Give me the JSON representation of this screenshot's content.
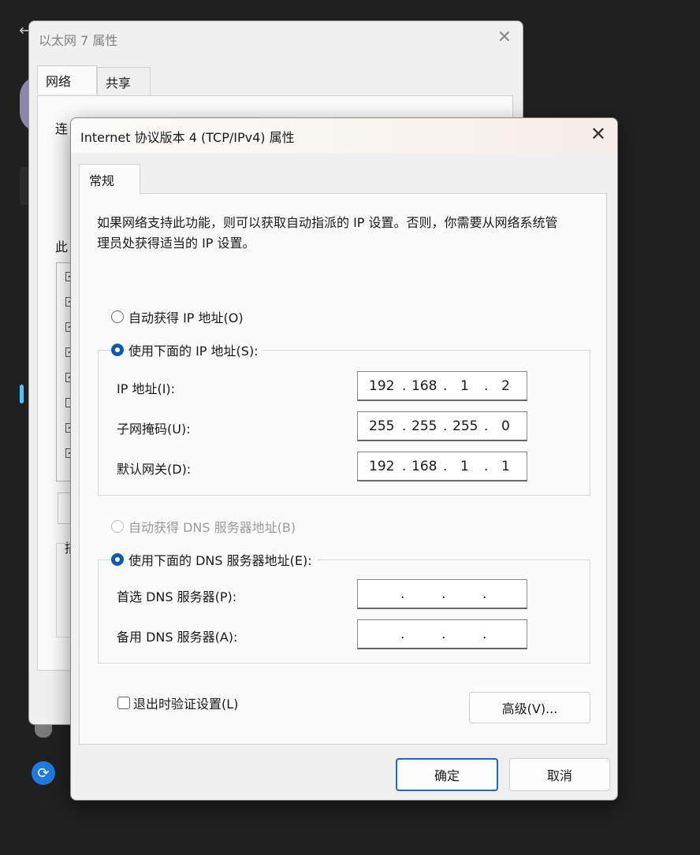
{
  "background_window": {
    "title": "以太网 7 属性",
    "tabs": [
      "网络",
      "共享"
    ],
    "fragment_connect": "连",
    "fragment_this": "此",
    "fragment_other": "描"
  },
  "dialog": {
    "title": "Internet 协议版本 4 (TCP/IPv4) 属性",
    "tab": "常规",
    "description": "如果网络支持此功能，则可以获取自动指派的 IP 设置。否则，你需要从网络系统管理员处获得适当的 IP 设置。",
    "radio_auto_ip": "自动获得 IP 地址(O)",
    "radio_manual_ip": "使用下面的 IP 地址(S):",
    "ip_label": "IP 地址(I):",
    "ip": [
      "192",
      "168",
      "1",
      "2"
    ],
    "subnet_label": "子网掩码(U):",
    "subnet": [
      "255",
      "255",
      "255",
      "0"
    ],
    "gateway_label": "默认网关(D):",
    "gateway": [
      "192",
      "168",
      "1",
      "1"
    ],
    "radio_auto_dns": "自动获得 DNS 服务器地址(B)",
    "radio_manual_dns": "使用下面的 DNS 服务器地址(E):",
    "preferred_dns_label": "首选 DNS 服务器(P):",
    "alternate_dns_label": "备用 DNS 服务器(A):",
    "validate_label": "退出时验证设置(L)",
    "advanced_button": "高级(V)...",
    "ok_button": "确定",
    "cancel_button": "取消"
  },
  "colors": {
    "accent": "#0c5bb0",
    "desktop": "#202020"
  }
}
